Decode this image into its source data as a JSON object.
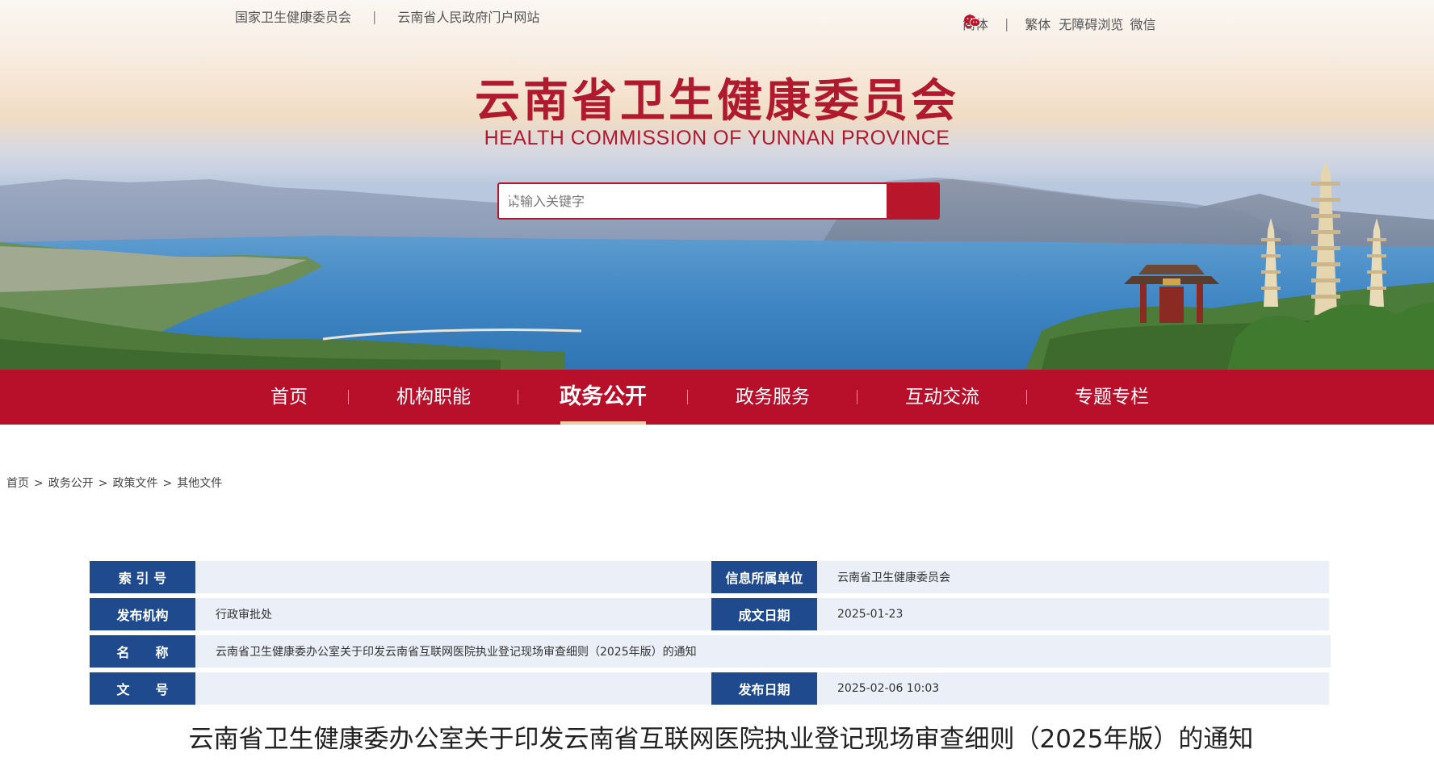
{
  "top_links": [
    "国家卫生健康委员会",
    "云南省人民政府门户网站"
  ],
  "tools": {
    "simplified": "简体",
    "traditional": "繁体",
    "accessible": "无障碍浏览",
    "wechat": "微信"
  },
  "site": {
    "title": "云南省卫生健康委员会",
    "subtitle": "HEALTH COMMISSION OF YUNNAN PROVINCE"
  },
  "search": {
    "placeholder": "请输入关键字",
    "value": ""
  },
  "nav": {
    "items": [
      "首页",
      "机构职能",
      "政务公开",
      "政务服务",
      "互动交流",
      "专题专栏"
    ],
    "active": "政务公开"
  },
  "breadcrumb": [
    "首页",
    "政务公开",
    "政策文件",
    "其他文件"
  ],
  "info": {
    "index_label": "索 引 号",
    "index_value": "",
    "unit_label": "信息所属单位",
    "unit_value": "云南省卫生健康委员会",
    "org_label": "发布机构",
    "org_value": "行政审批处",
    "formed_label": "成文日期",
    "formed_value": "2025-01-23",
    "name_label": "名　　称",
    "name_value": "云南省卫生健康委办公室关于印发云南省互联网医院执业登记现场审查细则（2025年版）的通知",
    "doc_label": "文　　号",
    "doc_value": "",
    "pub_label": "发布日期",
    "pub_value": "2025-02-06 10:03"
  },
  "document_title": "云南省卫生健康委办公室关于印发云南省互联网医院执业登记现场审查细则（2025年版）的通知",
  "colors": {
    "brand_red": "#b8102a",
    "title_red": "#b01a2e",
    "label_blue": "#1f4b8e",
    "cell_bg": "#eaeff8"
  }
}
